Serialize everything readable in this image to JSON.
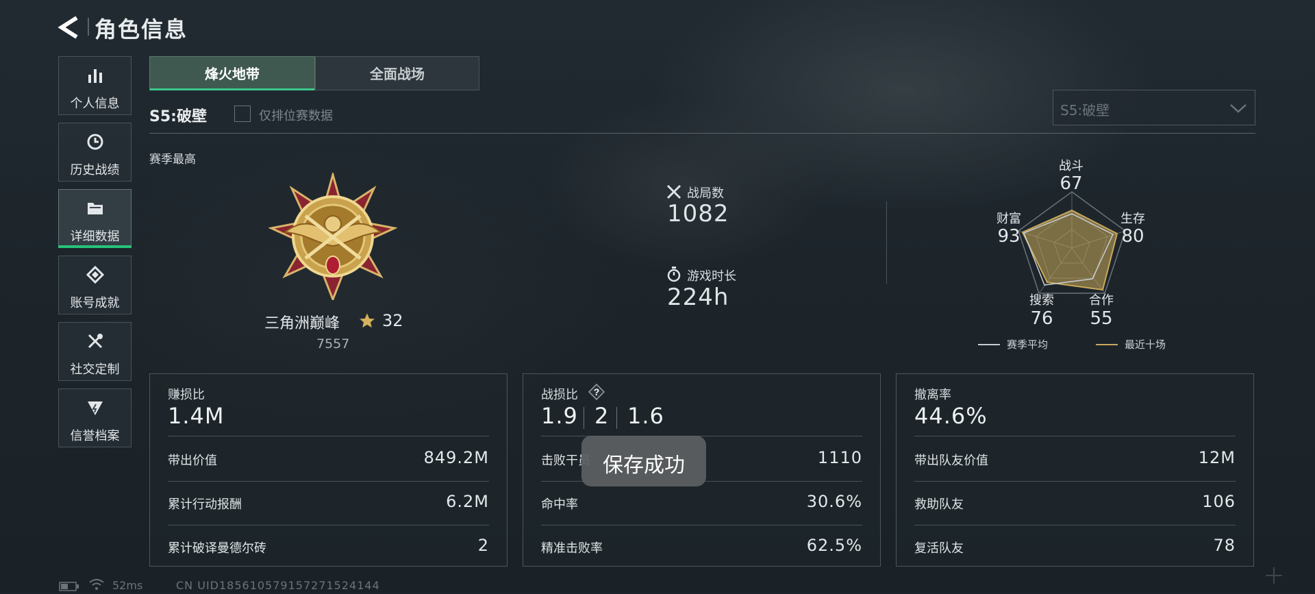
{
  "header": {
    "title": "角色信息"
  },
  "sidebar": {
    "items": [
      {
        "label": "个人信息",
        "icon": "bar-chart-icon",
        "active": false
      },
      {
        "label": "历史战绩",
        "icon": "history-icon",
        "active": false
      },
      {
        "label": "详细数据",
        "icon": "folder-icon",
        "active": true
      },
      {
        "label": "账号成就",
        "icon": "achievement-icon",
        "active": false
      },
      {
        "label": "社交定制",
        "icon": "tools-icon",
        "active": false
      },
      {
        "label": "信誉档案",
        "icon": "credit-icon",
        "active": false
      }
    ]
  },
  "tabs": [
    {
      "label": "烽火地带",
      "active": true
    },
    {
      "label": "全面战场",
      "active": false
    }
  ],
  "filter": {
    "season_label": "S5:破壁",
    "ranked_only_label": "仅排位赛数据",
    "ranked_only_checked": false,
    "season_select_value": "S5:破壁"
  },
  "summary": {
    "season_best_label": "赛季最高",
    "rank_name": "三角洲巅峰",
    "rank_stars": "32",
    "rank_score": "7557",
    "matches_label": "战局数",
    "matches_value": "1082",
    "playtime_label": "游戏时长",
    "playtime_value": "224h"
  },
  "radar": {
    "axes": [
      {
        "label": "战斗",
        "value": "67"
      },
      {
        "label": "生存",
        "value": "80"
      },
      {
        "label": "合作",
        "value": "55"
      },
      {
        "label": "搜索",
        "value": "76"
      },
      {
        "label": "财富",
        "value": "93"
      }
    ],
    "legend": [
      {
        "label": "赛季平均",
        "color": "#c8ced2"
      },
      {
        "label": "最近十场",
        "color": "#c9a95a"
      }
    ]
  },
  "cards": [
    {
      "title": "赚损比",
      "big": "1.4M",
      "rows": [
        {
          "label": "带出价值",
          "value": "849.2M"
        },
        {
          "label": "累计行动报酬",
          "value": "6.2M"
        },
        {
          "label": "累计破译曼德尔砖",
          "value": "2"
        }
      ]
    },
    {
      "title": "战损比",
      "ratios": [
        "1.9",
        "2",
        "1.6"
      ],
      "rows": [
        {
          "label": "击败干员",
          "value": "1110"
        },
        {
          "label": "命中率",
          "value": "30.6%"
        },
        {
          "label": "精准击败率",
          "value": "62.5%"
        }
      ]
    },
    {
      "title": "撤离率",
      "big": "44.6%",
      "rows": [
        {
          "label": "带出队友价值",
          "value": "12M"
        },
        {
          "label": "救助队友",
          "value": "106"
        },
        {
          "label": "复活队友",
          "value": "78"
        }
      ]
    }
  ],
  "toast": {
    "text": "保存成功"
  },
  "status": {
    "ping": "52ms",
    "uid": "CN UID185610579157271524144"
  }
}
